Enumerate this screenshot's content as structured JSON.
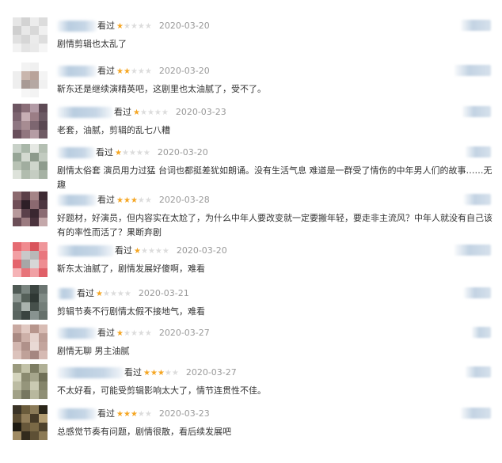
{
  "colors": {
    "star_on": "#f5a623",
    "star_off": "#dcdcdc",
    "date": "#999999",
    "text": "#333333"
  },
  "reviews": [
    {
      "watched": "看过",
      "rating": 1,
      "date": "2020-03-20",
      "text": "剧情剪辑也太乱了",
      "avatar": [
        "#e6e6e6",
        "#d3d3d3",
        "#ececec",
        "#dcdcdc",
        "#cfcfcf",
        "#e8e8e8",
        "#d8d8d8",
        "#f0f0f0",
        "#e0e0e0",
        "#d6d6d6",
        "#ebebeb",
        "#dedede",
        "#f2f2f2",
        "#e4e4e4",
        "#e9e9e9",
        "#f5f5f5"
      ]
    },
    {
      "watched": "看过",
      "rating": 2,
      "date": "2020-03-20",
      "text": "靳东还是继续演精英吧，这剧里也太油腻了，受不了。",
      "avatar": [
        "#ffffff",
        "#f3f3f3",
        "#f0f0f0",
        "#ffffff",
        "#eeeeee",
        "#c9b6ad",
        "#b9a39a",
        "#f4f4f4",
        "#eeeeee",
        "#a89a95",
        "#b5a8a3",
        "#f1f1f1",
        "#ffffff",
        "#f6f6f6",
        "#f3f3f3",
        "#ffffff"
      ]
    },
    {
      "watched": "看过",
      "rating": 1,
      "date": "2020-03-23",
      "text": "老套，油腻，剪辑的乱七八糟",
      "avatar": [
        "#6d5662",
        "#8a6e78",
        "#b29aa5",
        "#5e4a55",
        "#7c6470",
        "#c7aeb4",
        "#9b7e86",
        "#6b5963",
        "#8e7782",
        "#a78c92",
        "#7d6670",
        "#5a4852",
        "#684f5b",
        "#91767f",
        "#b59ca4",
        "#6f5b64"
      ]
    },
    {
      "watched": "看过",
      "rating": 1,
      "date": "2020-03-20",
      "text": "剧情太俗套 演员用力过猛 台词也都挺差犹如朗诵。没有生活气息 难道是一群受了情伤的中年男人们的故事……无趣",
      "avatar": [
        "#c8d1c8",
        "#a9b7a9",
        "#e5e8e3",
        "#b4bfb2",
        "#96a596",
        "#d3d9d0",
        "#8d9a8c",
        "#c2cbc0",
        "#b8c2b4",
        "#a1ad9f",
        "#cfd6cc",
        "#8f9c8e",
        "#dde2da",
        "#b1bcae",
        "#c5cdc2",
        "#a6b2a4"
      ]
    },
    {
      "watched": "看过",
      "rating": 3,
      "date": "2020-03-28",
      "text": "好题材，好演员，但内容实在太尬了，为什么中年人要改变就一定要搬年轻，要走非主流风？中年人就没有自己该有的率性而活了？果断弃剧",
      "avatar": [
        "#8c6a6f",
        "#5b3f48",
        "#a58487",
        "#3e2a33",
        "#6f4e57",
        "#2e1f27",
        "#8b6970",
        "#4d3640",
        "#b7999b",
        "#5a404a",
        "#3a2730",
        "#8a6b72",
        "#6c4f58",
        "#9b7b80",
        "#4b333d",
        "#c4a8aa"
      ]
    },
    {
      "watched": "看过",
      "rating": 1,
      "date": "2020-03-20",
      "text": "靳东太油腻了，剧情发展好傻啊，难看",
      "avatar": [
        "#e56b72",
        "#f08b8f",
        "#d9545c",
        "#ef969a",
        "#f29fa3",
        "#c9c9c9",
        "#b8b8b8",
        "#e9777e",
        "#e4646c",
        "#a7a7a7",
        "#d7d7d7",
        "#ee8d92",
        "#f5b3b6",
        "#e7747a",
        "#f0a0a4",
        "#e06068"
      ]
    },
    {
      "watched": "看过",
      "rating": 1,
      "date": "2020-03-21",
      "text": "剪辑节奏不行剧情太假不接地气，难看",
      "avatar": [
        "#4f5a55",
        "#7a8580",
        "#3c4642",
        "#6b7571",
        "#8f9994",
        "#556059",
        "#2f3834",
        "#7f8a85",
        "#606b66",
        "#aab3ae",
        "#46504b",
        "#737e79",
        "#5a6560",
        "#3a4440",
        "#889390",
        "#65706b"
      ]
    },
    {
      "watched": "看过",
      "rating": 1,
      "date": "2020-03-27",
      "text": "剧情无聊 男主油腻",
      "avatar": [
        "#c9a9a1",
        "#e1c9c2",
        "#b7958c",
        "#d8bcb4",
        "#a98a83",
        "#cdb0a8",
        "#e6d3cd",
        "#bc9d95",
        "#d2b6af",
        "#b0918a",
        "#e9d9d4",
        "#c3a59d",
        "#dcc3bc",
        "#bfa199",
        "#a58680",
        "#d6bab3"
      ]
    },
    {
      "watched": "看过",
      "rating": 3,
      "date": "2020-03-27",
      "text": "不太好看，可能受剪辑影响太大了，情节连贯性不佳。",
      "avatar": [
        "#9a9a7e",
        "#c2c2a8",
        "#7d7d63",
        "#b0b096",
        "#d4d4bd",
        "#8a8a70",
        "#a6a68c",
        "#6f6f57",
        "#bcbca3",
        "#95957b",
        "#cacab2",
        "#84846a",
        "#a1a187",
        "#767660",
        "#b8b89e",
        "#8f8f75"
      ]
    },
    {
      "watched": "看过",
      "rating": 3,
      "date": "2020-03-23",
      "text": "总感觉节奏有问题，剧情很散，看后续发展吧",
      "avatar": [
        "#3a3326",
        "#6b5c3c",
        "#8a7a58",
        "#2b2619",
        "#5a4c32",
        "#927e5a",
        "#453a27",
        "#b39d72",
        "#1f1b12",
        "#67573a",
        "#7a6946",
        "#4e422c",
        "#a08b63",
        "#332b1d",
        "#5e5035",
        "#8c7a55"
      ]
    }
  ]
}
